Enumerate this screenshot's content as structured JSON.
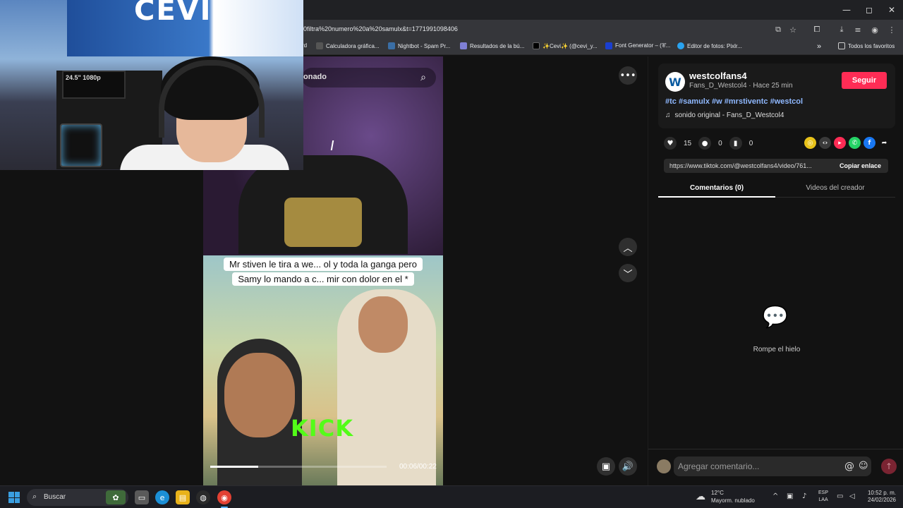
{
  "browser": {
    "url": "0filtra%20numero%20a%20samulx&t=1771991098406",
    "win_controls": [
      "—",
      "◻",
      "✕"
    ],
    "bookmarks": [
      {
        "label": "rd",
        "color": "#35363a"
      },
      {
        "label": "Calculadora gráfica...",
        "color": "#555"
      },
      {
        "label": "Nightbot - Spam Pr...",
        "color": "#3a6ea5"
      },
      {
        "label": "Resultados de la bú...",
        "color": "#7f7fd5"
      },
      {
        "label": "✨Cevi✨ (@cevi_y...",
        "color": "#000"
      },
      {
        "label": "Font Generator – (𝒞...",
        "color": "#1a3fd0"
      },
      {
        "label": "Editor de fotos: Pixlr...",
        "color": "#29a3f0"
      }
    ],
    "bookmarks_overflow": "»",
    "all_favorites": "Todos los favoritos"
  },
  "webcam": {
    "banner_text": "CEVI",
    "monitor_text": "24.5\" 1080p"
  },
  "video": {
    "search_text": "onado",
    "caption_lines": [
      "Mr stiven le tira a we... ol y toda la ganga pero",
      "Samy lo mando a c... mir con dolor en el *"
    ],
    "overlay_brand": "KICK",
    "time": "00:06/00:22",
    "progress": 0.27
  },
  "controls": {
    "more": "•••",
    "up": "︿",
    "down": "﹀",
    "mini": "▣",
    "volume": "🔊"
  },
  "panel": {
    "avatar_letter": "W",
    "username": "westcolfans4",
    "subline": "Fans_D_Westcol4 · Hace 25 min",
    "follow_label": "Seguir",
    "hashtags": "#tc #samulx #w #mrstiventc #westcol",
    "sound_icon": "♫",
    "sound": "sonido original - Fans_D_Westcol4",
    "likes": "15",
    "comments": "0",
    "saves": "0",
    "link": "https://www.tiktok.com/@westcolfans4/video/761...",
    "copy_label": "Copiar enlace",
    "tab_comments": "Comentarios (0)",
    "tab_videos": "Videos del creador",
    "empty_text": "Rompe el hielo",
    "comment_placeholder": "Agregar comentario...",
    "share_colors": [
      "#e8c21a",
      "#3a3a3a",
      "#fe2c55",
      "#25d366",
      "#1877f2",
      "#121212"
    ]
  },
  "taskbar": {
    "search": "Buscar",
    "weather_temp": "12°C",
    "weather_desc": "Mayorm. nublado",
    "lang_top": "ESP",
    "lang_bottom": "LAA",
    "time": "10:52 p. m.",
    "date": "24/02/2026"
  }
}
